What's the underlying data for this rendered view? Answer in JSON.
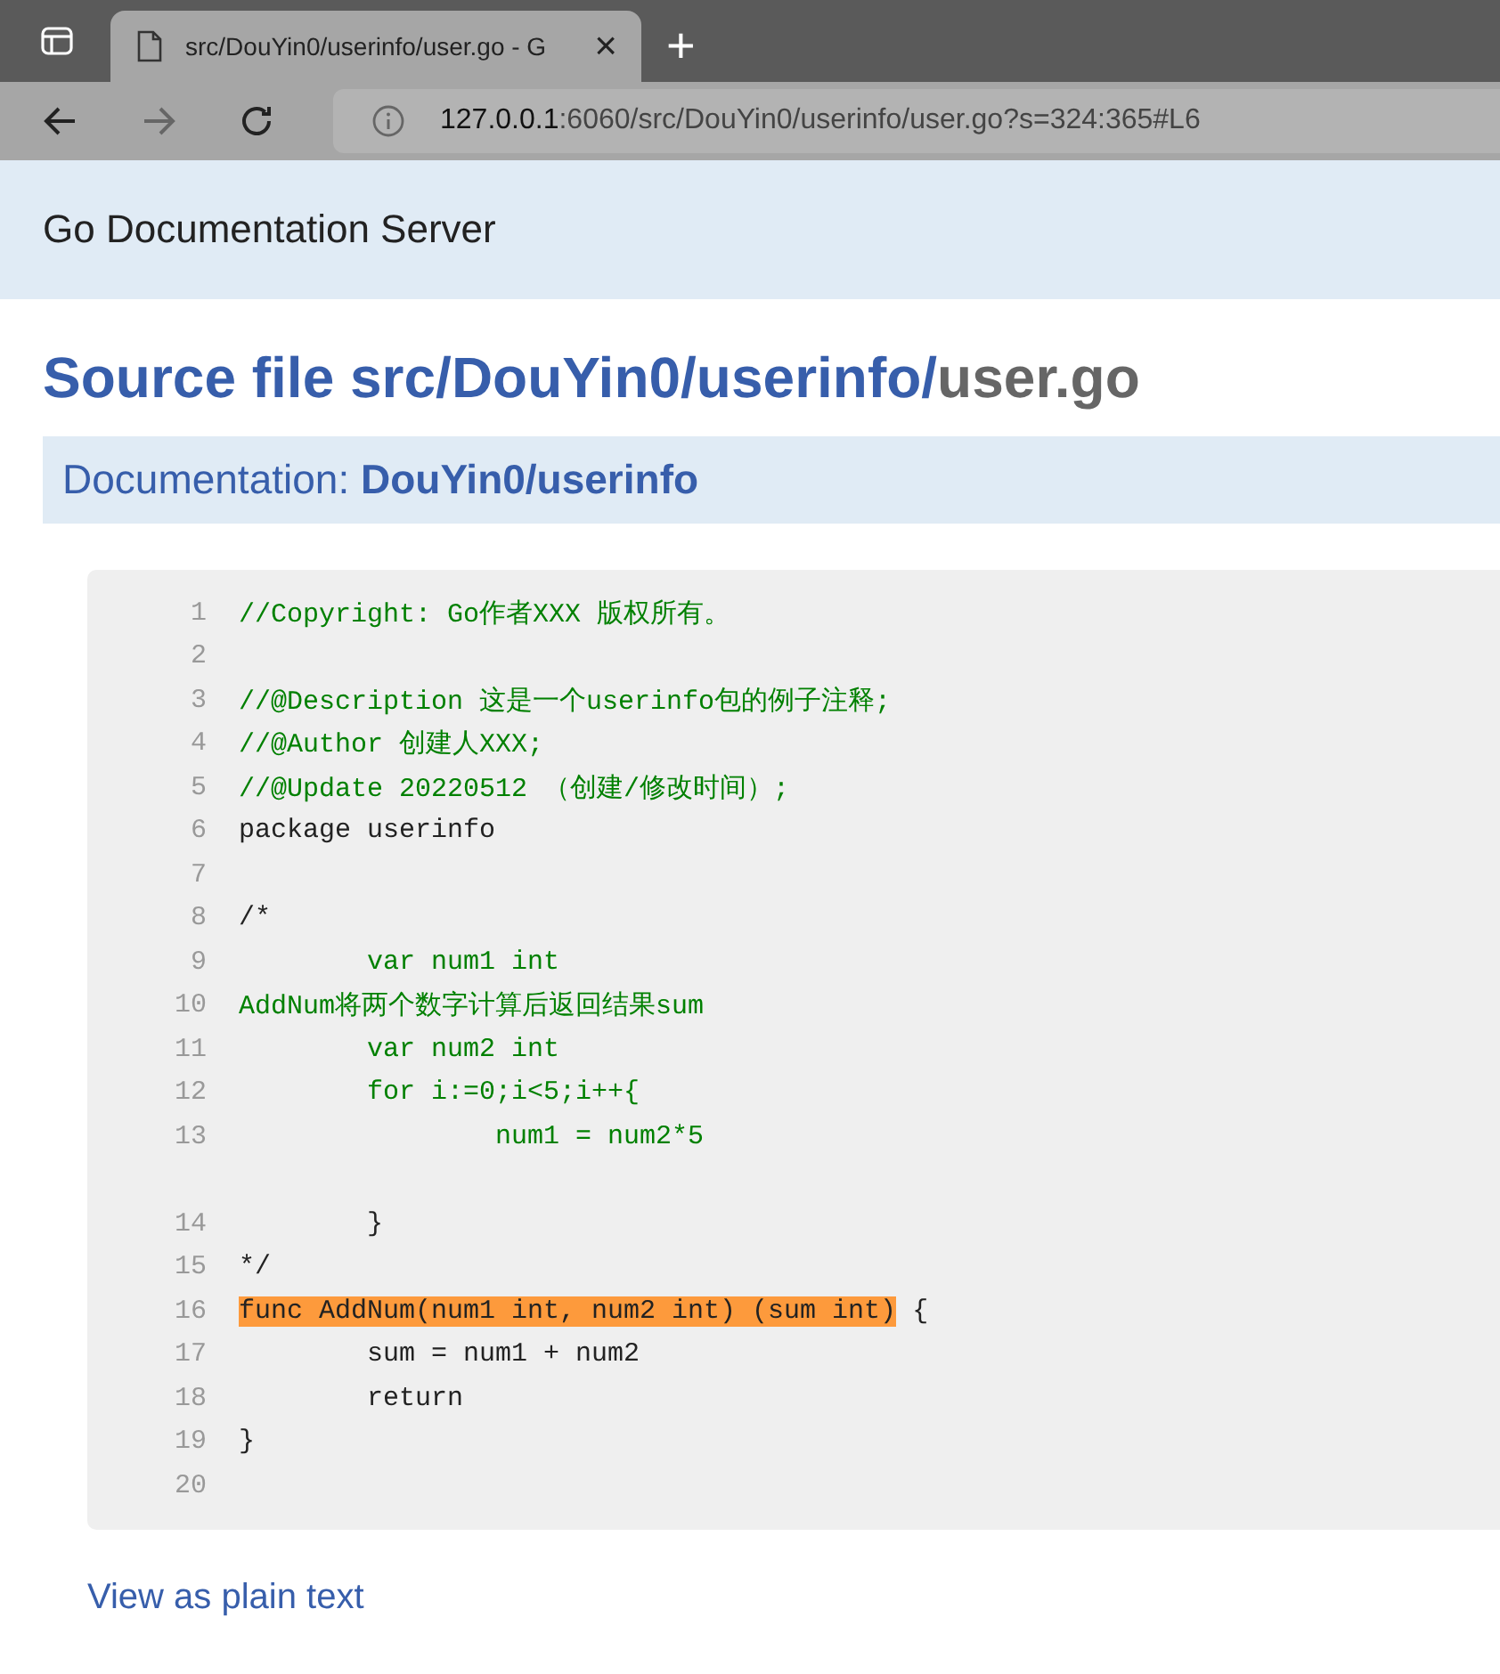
{
  "browser": {
    "tab": {
      "title": "src/DouYin0/userinfo/user.go - G",
      "close": "×",
      "selected": true
    },
    "new_tab": "+",
    "address": {
      "host": "127.0.0.1",
      "rest": ":6060/src/DouYin0/userinfo/user.go?s=324:365#L6"
    }
  },
  "header": {
    "title": "Go Documentation Server"
  },
  "page_title": {
    "path": "Source file src/DouYin0/userinfo/",
    "file": "user.go"
  },
  "documentation": {
    "label": "Documentation: ",
    "link": "DouYin0/userinfo"
  },
  "code": {
    "lines": [
      {
        "kind": "comment",
        "number": "1",
        "text": "//Copyright: Go作者XXX 版权所有。"
      },
      {
        "kind": "code",
        "number": "2"
      },
      {
        "kind": "comment",
        "number": "3",
        "text": "//@Description 这是一个userinfo包的例子注释;"
      },
      {
        "kind": "comment",
        "number": "4",
        "text": "//@Author 创建人XXX;"
      },
      {
        "kind": "comment",
        "number": "5",
        "text": "//@Update 20220512 （创建/修改时间）;"
      },
      {
        "kind": "code",
        "number": "6",
        "text": "package userinfo"
      },
      {
        "kind": "code",
        "number": "7"
      },
      {
        "kind": "code",
        "number": "8",
        "text": "/*"
      },
      {
        "kind": "comment",
        "number": "9",
        "text": "\tvar num1 int"
      },
      {
        "kind": "comment",
        "number": "10",
        "text": "AddNum将两个数字计算后返回结果sum"
      },
      {
        "kind": "comment",
        "number": "11",
        "text": "\tvar num2 int"
      },
      {
        "kind": "comment",
        "number": "12",
        "text": "\tfor i:=0;i<5;i++{"
      },
      {
        "kind": "comment",
        "number": "13",
        "text": "\t\tnum1 = num2*5"
      },
      {
        "kind": "blank"
      },
      {
        "kind": "code",
        "number": "14",
        "text": "\t}"
      },
      {
        "kind": "code",
        "number": "15",
        "text": "*/"
      },
      {
        "kind": "code",
        "number": "16",
        "highlight": "func AddNum(num1 int, num2 int) (sum int)",
        "text": " {"
      },
      {
        "kind": "code",
        "number": "17",
        "text": "\tsum = num1 + num2"
      },
      {
        "kind": "code",
        "number": "18",
        "text": "\treturn"
      },
      {
        "kind": "code",
        "number": "19",
        "text": "}"
      },
      {
        "kind": "code",
        "number": "20"
      }
    ]
  },
  "footer": {
    "link": "View as plain text"
  }
}
